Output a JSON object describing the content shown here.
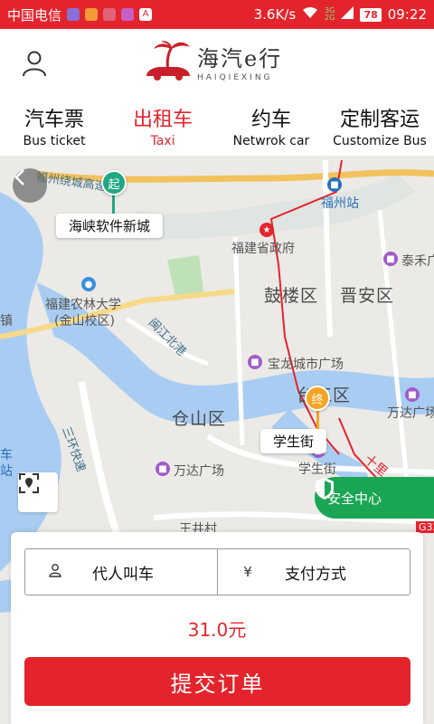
{
  "status_bar": {
    "carrier": "中国电信",
    "speed": "3.6K/s",
    "battery": "78",
    "time": "09:22",
    "net_top": "3G",
    "net_bottom": "2G"
  },
  "header": {
    "logo_cn": "海汽e行",
    "logo_en": "HAIQIEXING",
    "logo_icon": "palm-car-icon",
    "user_icon": "user-icon"
  },
  "tabs": [
    {
      "cn": "汽车票",
      "en": "Bus ticket",
      "active": false
    },
    {
      "cn": "出租车",
      "en": "Taxi",
      "active": true
    },
    {
      "cn": "约车",
      "en": "Netwrok car",
      "active": false
    },
    {
      "cn": "定制客运",
      "en": "Customize Bus",
      "active": false
    }
  ],
  "map": {
    "start_marker": "起",
    "start_label": "海峡软件新城",
    "end_marker": "终",
    "end_label": "学生街",
    "labels": {
      "fuzhou_station": "福州站",
      "fujian_gov": "福建省政府",
      "taifeng": "泰禾广",
      "gulou": "鼓楼区",
      "jinan": "晋安区",
      "agri_univ_1": "福建农林大学",
      "agri_univ_2": "(金山校区)",
      "minjiang_road": "闽江北港",
      "baolong": "宝龙城市广场",
      "taijiang": "台江区",
      "wanda1": "万达广场",
      "cangshan": "仓山区",
      "sanhuan": "三环快速",
      "wanda2": "万达广场",
      "xueshengjie_poi": "学生街",
      "highway": "福州绕城高速",
      "x115": "X115",
      "zhen": "镇",
      "che": "车",
      "zhan": "站",
      "shili": "十里",
      "g32": "G32",
      "bottom_cut": "王井村"
    },
    "safety_label": "安全中心",
    "back_icon": "chevron-left-icon",
    "locate_icon": "locate-icon",
    "shield_icon": "shield-icon"
  },
  "order": {
    "proxy_label": "代人叫车",
    "proxy_icon": "person-icon",
    "payment_label": "支付方式",
    "payment_icon": "yen-icon",
    "price": "31.0元",
    "submit_label": "提交订单"
  },
  "colors": {
    "brand_red": "#e4242c",
    "safety_green": "#1aa655",
    "start_green": "#1fa882",
    "end_orange": "#f5a524"
  }
}
